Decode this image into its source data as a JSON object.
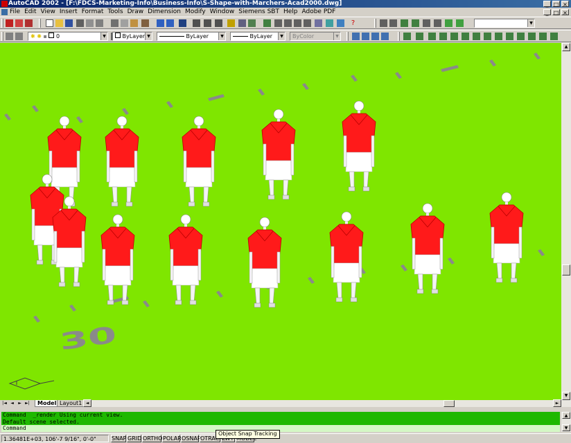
{
  "window": {
    "title": "AutoCAD 2002 - [F:\\FDCS-Marketing-Info\\Business-Info\\S-Shape-with-Marchers-Acad2000.dwg]"
  },
  "window_controls": [
    "_",
    "□",
    "×"
  ],
  "doc_controls": [
    "_",
    "□",
    "×"
  ],
  "menu": [
    "File",
    "Edit",
    "View",
    "Insert",
    "Format",
    "Tools",
    "Draw",
    "Dimension",
    "Modify",
    "Window",
    "Siemens SBT",
    "Help",
    "Adobe PDF"
  ],
  "layers_toolbar": {
    "layer_value": "0",
    "color_value": "ByLayer",
    "linetype_value": "ByLayer",
    "lineweight_value": "ByLayer",
    "plotstyle_value": "ByColor"
  },
  "scene": {
    "field_color": "#7fe600",
    "yard_number": "30",
    "uniform_top": "#ff1a1a",
    "uniform_bottom": "#ffffff"
  },
  "layout_tabs": [
    "Model",
    "Layout1"
  ],
  "tab_nav": [
    "|◄",
    "◄",
    "►",
    "►|"
  ],
  "command_lines": [
    "Command  _render Using current view.",
    "Default scene selected.",
    "Command"
  ],
  "status": {
    "coords": "1.36481E+03, 106'-7 9/16\", 0'-0\"",
    "toggles": [
      "SNAP",
      "GRID",
      "ORTHO",
      "POLAR",
      "OSNAP",
      "OTRACK",
      "LWT",
      "MODEL"
    ]
  },
  "tooltip": "Object Snap Tracking"
}
